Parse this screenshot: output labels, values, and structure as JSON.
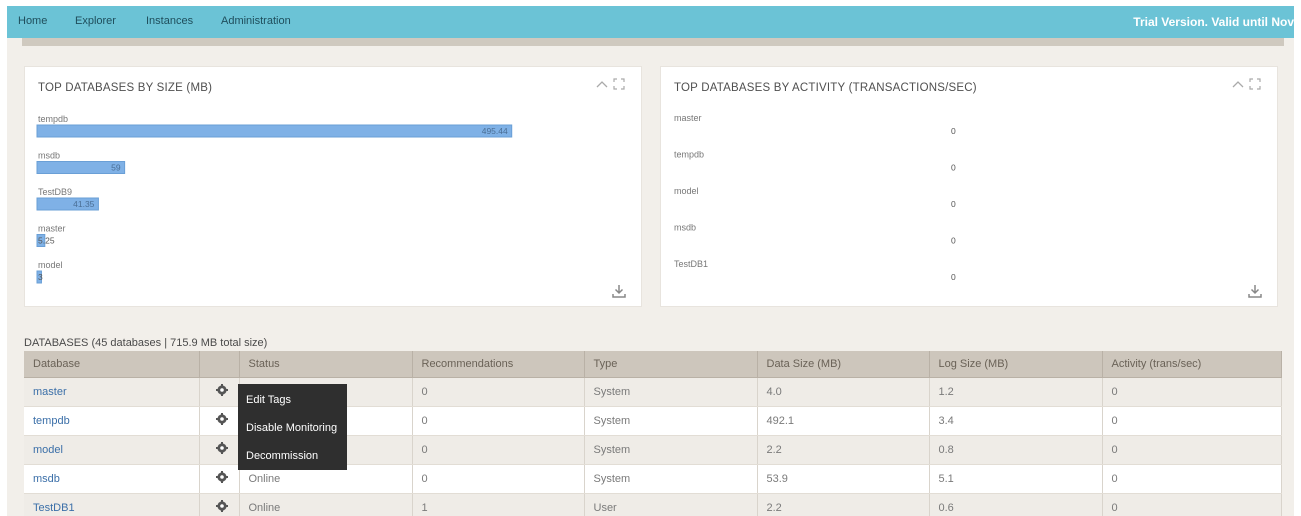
{
  "nav": {
    "items": [
      {
        "label": "Home"
      },
      {
        "label": "Explorer"
      },
      {
        "label": "Instances"
      },
      {
        "label": "Administration"
      }
    ],
    "trial_text": "Trial Version. Valid until Nov"
  },
  "size_chart": {
    "title": "TOP DATABASES BY SIZE (MB)",
    "chart_data": {
      "type": "bar",
      "orientation": "horizontal",
      "title": "TOP DATABASES BY SIZE (MB)",
      "categories": [
        "tempdb",
        "msdb",
        "TestDB9",
        "master",
        "model"
      ],
      "values": [
        495.44,
        59,
        41.35,
        5.25,
        3
      ],
      "value_labels": [
        "495.44",
        "59",
        "41.35",
        "5.25",
        "3"
      ],
      "xlim": [
        0,
        550
      ],
      "grid": false
    }
  },
  "activity_chart": {
    "title": "TOP DATABASES BY ACTIVITY (TRANSACTIONS/SEC)",
    "chart_data": {
      "type": "bar",
      "orientation": "horizontal",
      "title": "TOP DATABASES BY ACTIVITY (TRANSACTIONS/SEC)",
      "categories": [
        "master",
        "tempdb",
        "model",
        "msdb",
        "TestDB1"
      ],
      "values": [
        0,
        0,
        0,
        0,
        0
      ],
      "value_labels": [
        "0",
        "0",
        "0",
        "0",
        "0"
      ],
      "grid": false
    }
  },
  "databases": {
    "summary": "DATABASES (45 databases | 715.9 MB total size)",
    "columns": [
      "Database",
      "",
      "Status",
      "Recommendations",
      "Type",
      "Data Size (MB)",
      "Log Size (MB)",
      "Activity (trans/sec)"
    ],
    "rows": [
      {
        "name": "master",
        "status": "",
        "recommendations": "0",
        "type": "System",
        "data_size": "4.0",
        "log_size": "1.2",
        "activity": "0"
      },
      {
        "name": "tempdb",
        "status": "",
        "recommendations": "0",
        "type": "System",
        "data_size": "492.1",
        "log_size": "3.4",
        "activity": "0"
      },
      {
        "name": "model",
        "status": "",
        "recommendations": "0",
        "type": "System",
        "data_size": "2.2",
        "log_size": "0.8",
        "activity": "0"
      },
      {
        "name": "msdb",
        "status": "Online",
        "recommendations": "0",
        "type": "System",
        "data_size": "53.9",
        "log_size": "5.1",
        "activity": "0"
      },
      {
        "name": "TestDB1",
        "status": "Online",
        "recommendations": "1",
        "type": "User",
        "data_size": "2.2",
        "log_size": "0.6",
        "activity": "0"
      }
    ]
  },
  "context_menu": {
    "items": [
      {
        "label": "Edit Tags"
      },
      {
        "label": "Disable Monitoring"
      },
      {
        "label": "Decommission"
      }
    ]
  }
}
